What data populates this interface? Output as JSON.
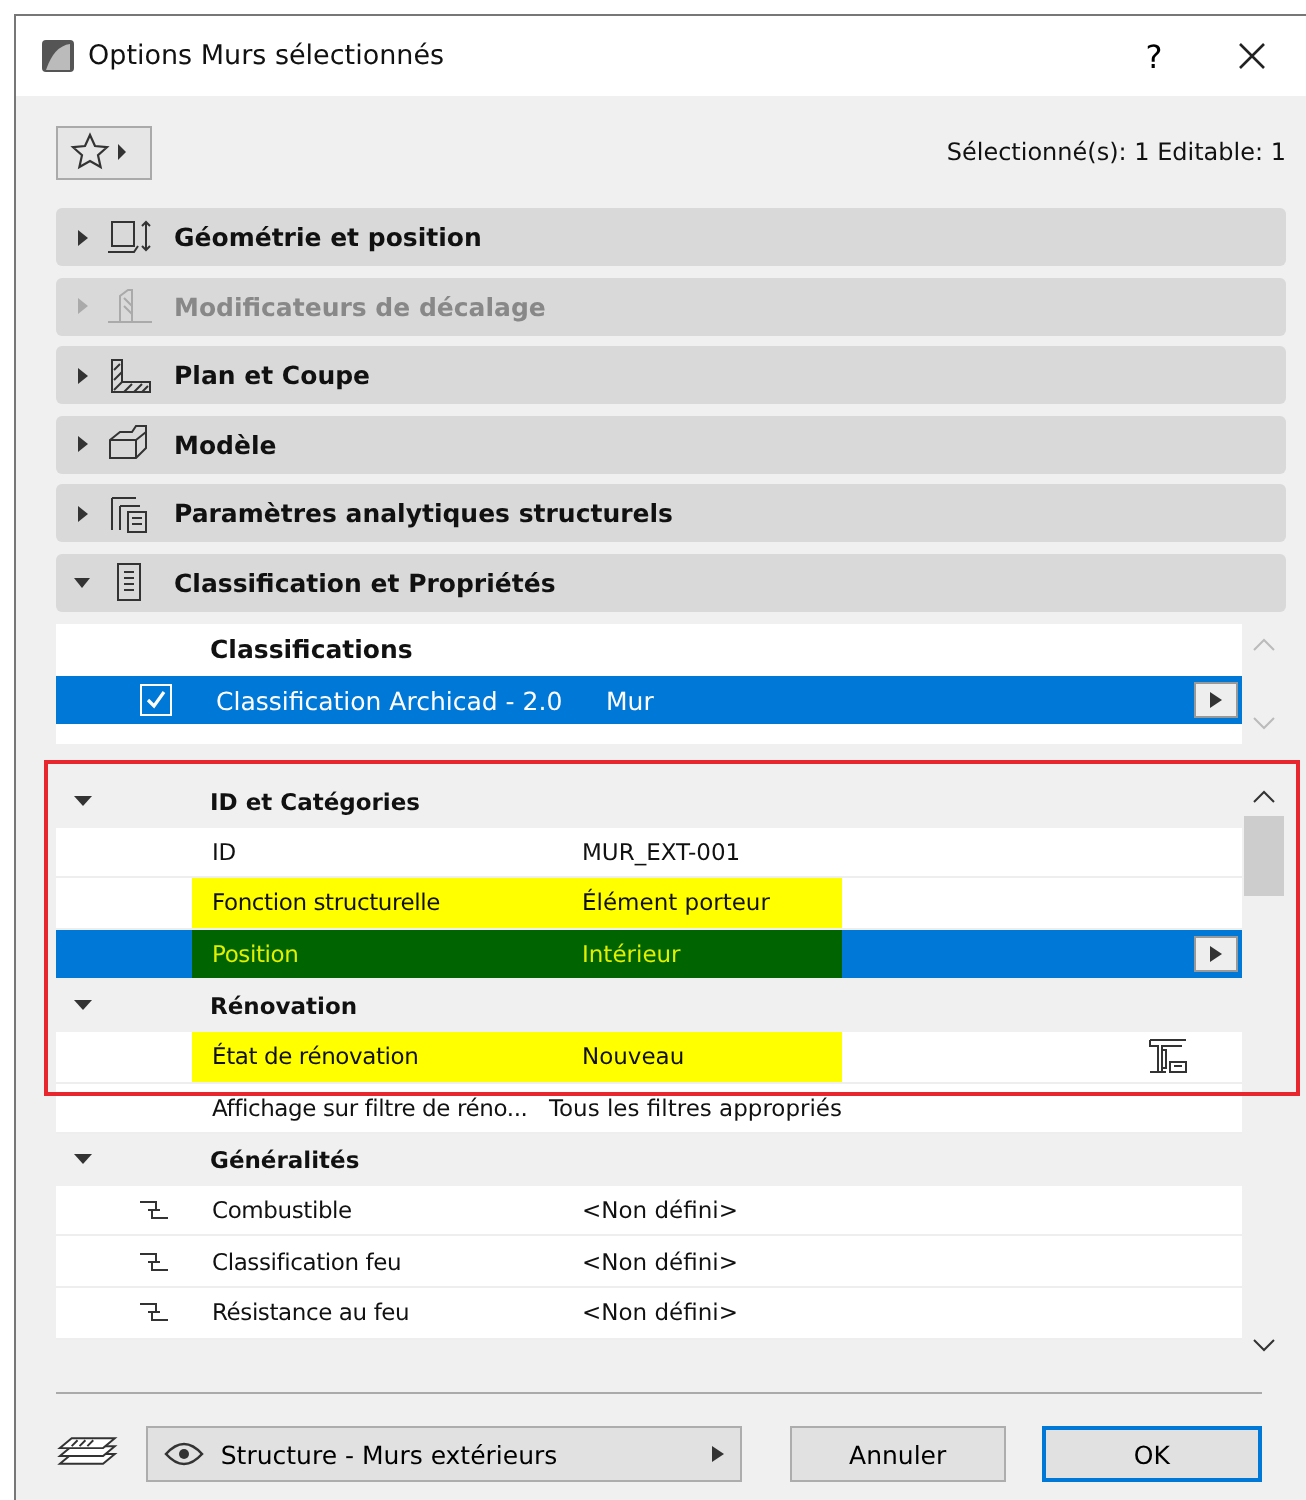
{
  "window": {
    "title": "Options Murs sélectionnés",
    "help": "?"
  },
  "selection_info": "Sélectionné(s): 1 Editable: 1",
  "panels": [
    {
      "kind": "geometry",
      "label": "Géométrie et position",
      "expanded": false,
      "disabled": false
    },
    {
      "kind": "offset",
      "label": "Modificateurs de décalage",
      "expanded": false,
      "disabled": true
    },
    {
      "kind": "plan",
      "label": "Plan et Coupe",
      "expanded": false,
      "disabled": false
    },
    {
      "kind": "model",
      "label": "Modèle",
      "expanded": false,
      "disabled": false
    },
    {
      "kind": "analytic",
      "label": "Paramètres analytiques structurels",
      "expanded": false,
      "disabled": false
    },
    {
      "kind": "classification",
      "label": "Classification et Propriétés",
      "expanded": true,
      "disabled": false
    }
  ],
  "classifications": {
    "header": "Classifications",
    "rows": [
      {
        "system": "Classification Archicad - 2.0",
        "value": "Mur",
        "checked": true,
        "selected": true
      }
    ]
  },
  "property_groups": [
    {
      "name": "ID et Catégories",
      "expanded": true,
      "rows": [
        {
          "kind": "plain",
          "label": "ID",
          "value": "MUR_EXT-001",
          "selected": false,
          "highlighted": false
        },
        {
          "kind": "plain",
          "label": "Fonction structurelle",
          "value": "Élément porteur",
          "selected": false,
          "highlighted": true
        },
        {
          "kind": "plain",
          "label": "Position",
          "value": "Intérieur",
          "selected": true,
          "highlighted": true
        }
      ]
    },
    {
      "name": "Rénovation",
      "expanded": true,
      "rows": [
        {
          "kind": "renovation",
          "label": "État de rénovation",
          "value": "Nouveau",
          "selected": false,
          "highlighted": true
        },
        {
          "kind": "plain",
          "label": "Affichage sur filtre de réno...",
          "value": "Tous les filtres appropriés",
          "selected": false,
          "highlighted": false
        }
      ]
    },
    {
      "name": "Généralités",
      "expanded": true,
      "rows": [
        {
          "kind": "linked",
          "label": "Combustible",
          "value": "<Non défini>",
          "selected": false,
          "highlighted": false
        },
        {
          "kind": "linked",
          "label": "Classification feu",
          "value": "<Non défini>",
          "selected": false,
          "highlighted": false
        },
        {
          "kind": "linked",
          "label": "Résistance au feu",
          "value": "<Non défini>",
          "selected": false,
          "highlighted": false
        }
      ]
    }
  ],
  "footer": {
    "view": "Structure - Murs extérieurs",
    "buttons": [
      {
        "label": "Annuler",
        "default": false
      },
      {
        "label": "OK",
        "default": true
      }
    ]
  }
}
